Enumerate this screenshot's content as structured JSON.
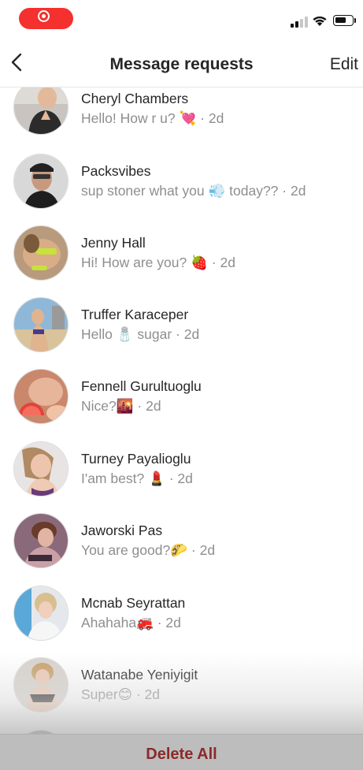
{
  "header": {
    "title": "Message requests",
    "edit_label": "Edit"
  },
  "status": {
    "battery_level": 0.7
  },
  "requests": [
    {
      "name": "Cheryl Chambers",
      "preview": "Hello! How r u? 💘",
      "time": "· 2d"
    },
    {
      "name": "Packsvibes",
      "preview": "sup stoner what you 💨 today??",
      "time": "· 2d"
    },
    {
      "name": "Jenny Hall",
      "preview": "Hi! How are you? 🍓",
      "time": "· 2d"
    },
    {
      "name": "Truffer Karaceper",
      "preview": "Hello 🧂 sugar",
      "time": "· 2d"
    },
    {
      "name": "Fennell Gurultuoglu",
      "preview": "Nice?🌇",
      "time": "· 2d"
    },
    {
      "name": "Turney Payalioglu",
      "preview": "I'am best? 💄",
      "time": "· 2d"
    },
    {
      "name": "Jaworski Pas",
      "preview": "You are good?🌮",
      "time": "· 2d"
    },
    {
      "name": "Mcnab Seyrattan",
      "preview": "Ahahaha🚒",
      "time": "· 2d"
    },
    {
      "name": "Watanabe Yeniyigit",
      "preview": "Super😊",
      "time": "· 2d"
    }
  ],
  "footer": {
    "delete_all_label": "Delete All"
  },
  "colors": {
    "recording": "#f4312f",
    "delete": "#8c2a2a",
    "secondary_text": "#8e8e8e"
  }
}
